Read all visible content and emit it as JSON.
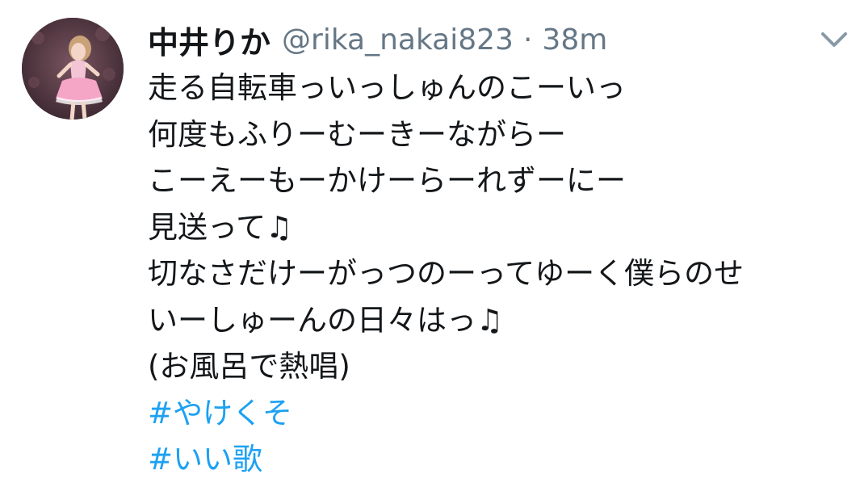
{
  "tweet": {
    "display_name": "中井りか",
    "handle": "@rika_nakai823",
    "separator": "·",
    "timestamp": "38m",
    "lines": [
      "走る自転車っいっしゅんのこーいっ",
      "何度もふりーむーきーながらー",
      "こーえーもーかけーらーれずーにー",
      "見送って♫",
      "切なさだけーがっつのーってゆーく僕らのせ",
      "いーしゅーんの日々はっ♫",
      "(お風呂で熱唱)"
    ],
    "hashtags": [
      "#やけくそ",
      "#いい歌"
    ]
  },
  "icons": {
    "menu": "chevron-down-icon",
    "avatar": "profile-photo"
  },
  "colors": {
    "text": "#14171a",
    "secondary": "#657786",
    "link": "#1da1f2",
    "background": "#ffffff"
  }
}
